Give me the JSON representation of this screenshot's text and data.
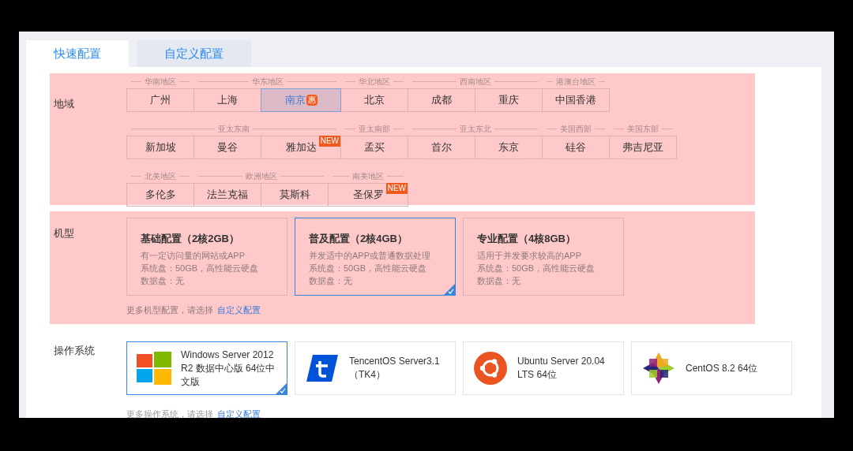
{
  "tabs": [
    {
      "label": "快速配置",
      "selected": true
    },
    {
      "label": "自定义配置",
      "selected": false
    }
  ],
  "region": {
    "label": "地域",
    "rows": [
      {
        "groups": [
          {
            "group": "华南地区",
            "cells": [
              {
                "name": "广州",
                "selected": false
              }
            ]
          },
          {
            "group": "华东地区",
            "cells": [
              {
                "name": "上海",
                "selected": false
              },
              {
                "name": "南京",
                "selected": true,
                "badge": {
                  "text": "惠",
                  "kind": "inline"
                }
              }
            ]
          },
          {
            "group": "华北地区",
            "cells": [
              {
                "name": "北京",
                "selected": false
              }
            ]
          },
          {
            "group": "西南地区",
            "cells": [
              {
                "name": "成都",
                "selected": false
              },
              {
                "name": "重庆",
                "selected": false
              }
            ]
          },
          {
            "group": "港澳台地区",
            "cells": [
              {
                "name": "中国香港",
                "selected": false
              }
            ]
          }
        ]
      },
      {
        "groups": [
          {
            "group": "亚太东南",
            "cells": [
              {
                "name": "新加坡",
                "selected": false
              },
              {
                "name": "曼谷",
                "selected": false
              },
              {
                "name": "雅加达",
                "selected": false,
                "badge": {
                  "text": "NEW",
                  "kind": "corner"
                }
              }
            ]
          },
          {
            "group": "亚太南部",
            "cells": [
              {
                "name": "孟买",
                "selected": false
              }
            ]
          },
          {
            "group": "亚太东北",
            "cells": [
              {
                "name": "首尔",
                "selected": false
              },
              {
                "name": "东京",
                "selected": false
              }
            ]
          },
          {
            "group": "美国西部",
            "cells": [
              {
                "name": "硅谷",
                "selected": false
              }
            ]
          },
          {
            "group": "美国东部",
            "cells": [
              {
                "name": "弗吉尼亚",
                "selected": false
              }
            ]
          }
        ]
      },
      {
        "groups": [
          {
            "group": "北美地区",
            "cells": [
              {
                "name": "多伦多",
                "selected": false
              }
            ]
          },
          {
            "group": "欧洲地区",
            "cells": [
              {
                "name": "法兰克福",
                "selected": false
              },
              {
                "name": "莫斯科",
                "selected": false
              }
            ]
          },
          {
            "group": "南美地区",
            "cells": [
              {
                "name": "圣保罗",
                "selected": false,
                "badge": {
                  "text": "NEW",
                  "kind": "corner"
                }
              }
            ]
          }
        ]
      }
    ]
  },
  "instance": {
    "label": "机型",
    "cards": [
      {
        "title": "基础配置（2核2GB）",
        "lines": [
          "有一定访问量的网站或APP",
          "系统盘：50GB，高性能云硬盘",
          "数据盘：无"
        ],
        "selected": false
      },
      {
        "title": "普及配置（2核4GB）",
        "lines": [
          "并发适中的APP或普通数据处理",
          "系统盘：50GB，高性能云硬盘",
          "数据盘：无"
        ],
        "selected": true
      },
      {
        "title": "专业配置（4核8GB）",
        "lines": [
          "适用于并发要求较高的APP",
          "系统盘：50GB，高性能云硬盘",
          "数据盘：无"
        ],
        "selected": false
      }
    ],
    "more_text": "更多机型配置，请选择",
    "more_link": "自定义配置"
  },
  "os": {
    "label": "操作系统",
    "cards": [
      {
        "kind": "windows",
        "name": "Windows Server 2012 R2 数据中心版 64位中文版",
        "selected": true
      },
      {
        "kind": "tencent",
        "name": "TencentOS Server3.1（TK4）",
        "selected": false
      },
      {
        "kind": "ubuntu",
        "name": "Ubuntu Server 20.04 LTS 64位",
        "selected": false
      },
      {
        "kind": "centos",
        "name": "CentOS 8.2 64位",
        "selected": false
      }
    ],
    "more_text": "更多操作系统，请选择",
    "more_link": "自定义配置"
  }
}
